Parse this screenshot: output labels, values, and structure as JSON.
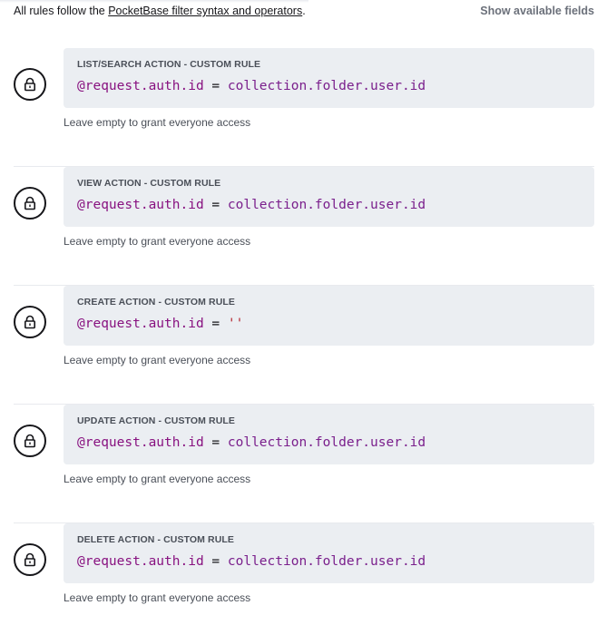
{
  "intro": {
    "prefix": "All rules follow the ",
    "link": "PocketBase filter syntax and operators",
    "suffix": "."
  },
  "show_fields_label": "Show available fields",
  "hint_text": "Leave empty to grant everyone access",
  "rules": [
    {
      "label": "LIST/SEARCH ACTION - CUSTOM RULE",
      "lhs": "@request.auth.id",
      "op": " = ",
      "rhs": "collection.folder.user.id",
      "rhs_type": "field"
    },
    {
      "label": "VIEW ACTION - CUSTOM RULE",
      "lhs": "@request.auth.id",
      "op": " = ",
      "rhs": "collection.folder.user.id",
      "rhs_type": "field"
    },
    {
      "label": "CREATE ACTION - CUSTOM RULE",
      "lhs": "@request.auth.id",
      "op": " = ",
      "rhs": "''",
      "rhs_type": "string"
    },
    {
      "label": "UPDATE ACTION - CUSTOM RULE",
      "lhs": "@request.auth.id",
      "op": " = ",
      "rhs": "collection.folder.user.id",
      "rhs_type": "field"
    },
    {
      "label": "DELETE ACTION - CUSTOM RULE",
      "lhs": "@request.auth.id",
      "op": " = ",
      "rhs": "collection.folder.user.id",
      "rhs_type": "field"
    }
  ],
  "icons": {
    "lock": "lock-icon"
  }
}
